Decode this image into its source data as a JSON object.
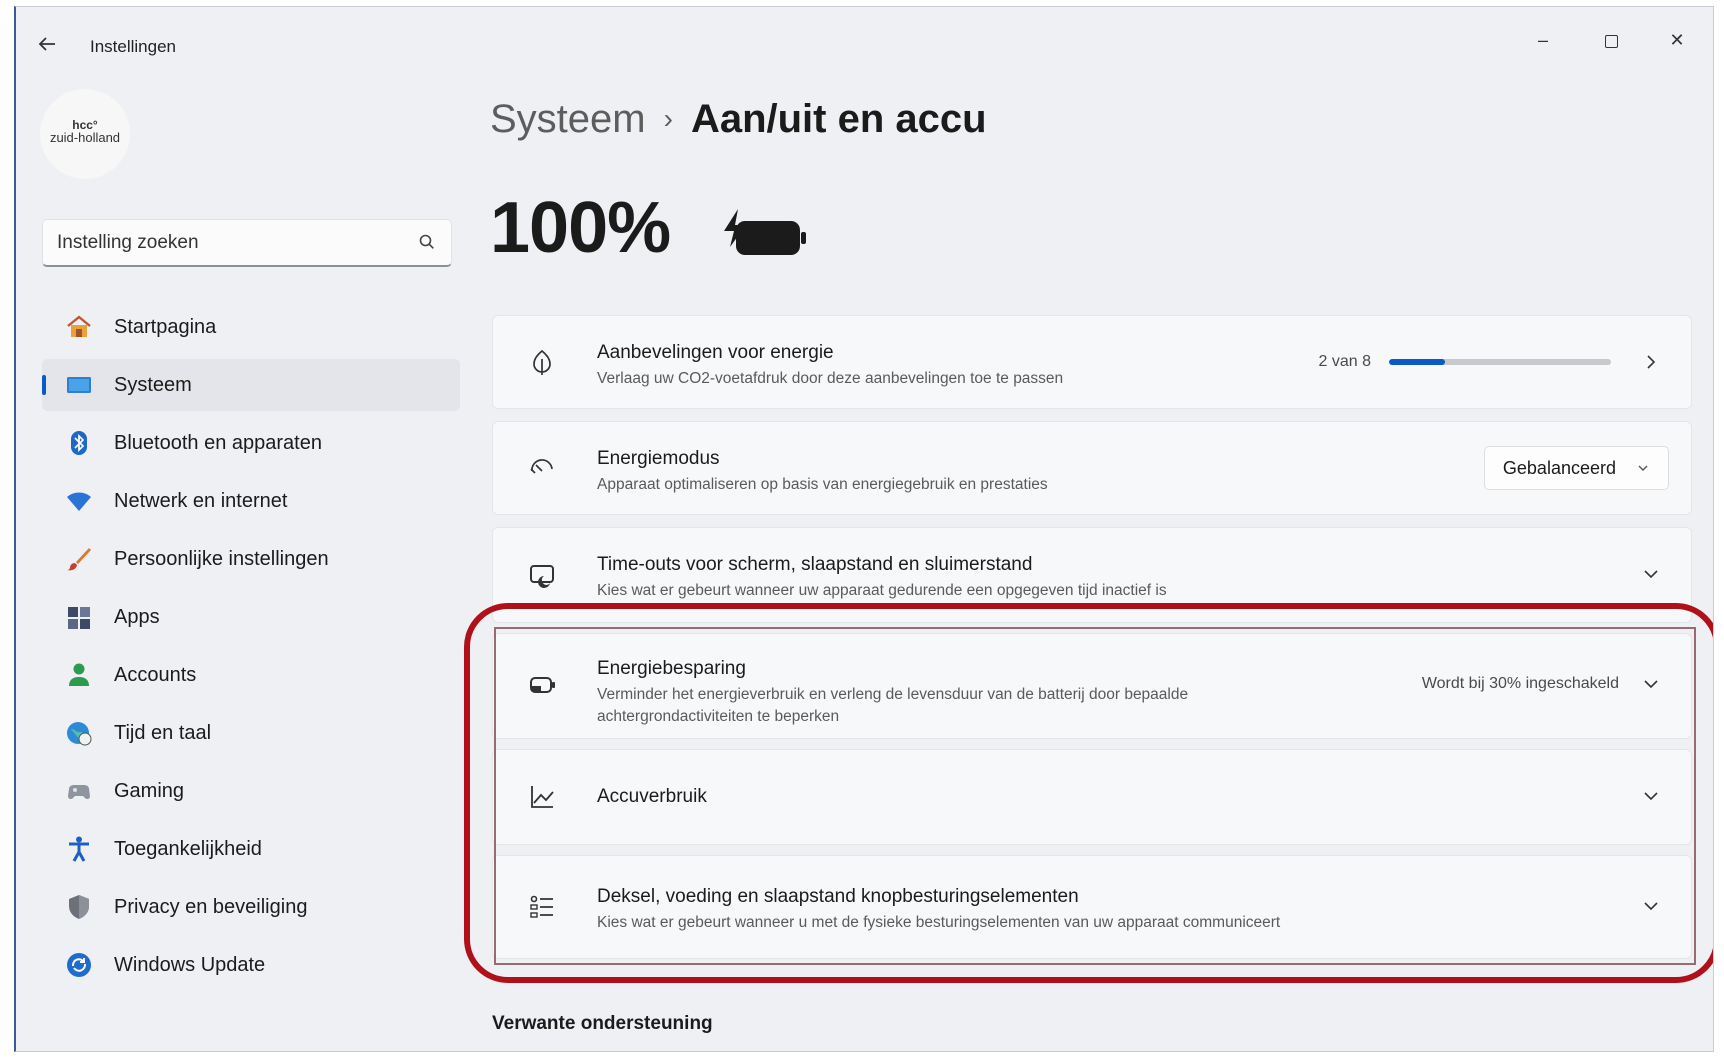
{
  "window": {
    "title": "Instellingen",
    "controls": {
      "minimize": "–",
      "close": "✕"
    }
  },
  "account": {
    "logo_line1": "hcc°",
    "logo_line2": "zuid-holland"
  },
  "search": {
    "placeholder": "Instelling zoeken"
  },
  "nav": {
    "items": [
      {
        "label": "Startpagina",
        "icon": "home-icon"
      },
      {
        "label": "Systeem",
        "icon": "system-icon",
        "active": true
      },
      {
        "label": "Bluetooth en apparaten",
        "icon": "bluetooth-icon"
      },
      {
        "label": "Netwerk en internet",
        "icon": "wifi-icon"
      },
      {
        "label": "Persoonlijke instellingen",
        "icon": "brush-icon"
      },
      {
        "label": "Apps",
        "icon": "apps-icon"
      },
      {
        "label": "Accounts",
        "icon": "accounts-icon"
      },
      {
        "label": "Tijd en taal",
        "icon": "globe-clock-icon"
      },
      {
        "label": "Gaming",
        "icon": "gamepad-icon"
      },
      {
        "label": "Toegankelijkheid",
        "icon": "accessibility-icon"
      },
      {
        "label": "Privacy en beveiliging",
        "icon": "shield-icon"
      },
      {
        "label": "Windows Update",
        "icon": "update-icon"
      }
    ]
  },
  "breadcrumb": {
    "parent": "Systeem",
    "separator": "›",
    "current": "Aan/uit en accu"
  },
  "battery": {
    "percent": "100%",
    "charging": true
  },
  "cards": {
    "recommendations": {
      "title": "Aanbevelingen voor energie",
      "subtitle": "Verlaag uw CO2-voetafdruk door deze aanbevelingen toe te passen",
      "progress_text": "2 van 8",
      "progress_value": 0.25
    },
    "power_mode": {
      "title": "Energiemodus",
      "subtitle": "Apparaat optimaliseren op basis van energiegebruik en prestaties",
      "selected": "Gebalanceerd"
    },
    "timeouts": {
      "title": "Time-outs voor scherm, slaapstand en sluimerstand",
      "subtitle": "Kies wat er gebeurt wanneer uw apparaat gedurende een opgegeven tijd inactief is"
    },
    "energy_saver": {
      "title": "Energiebesparing",
      "subtitle": "Verminder het energieverbruik en verleng de levensduur van de batterij door bepaalde achtergrondactiviteiten te beperken",
      "status": "Wordt bij 30% ingeschakeld"
    },
    "battery_usage": {
      "title": "Accuverbruik"
    },
    "lid_power": {
      "title": "Deksel, voeding en slaapstand knopbesturingselementen",
      "subtitle": "Kies wat er gebeurt wanneer u met de fysieke besturingselementen van uw apparaat communiceert"
    }
  },
  "related": {
    "heading": "Verwante ondersteuning"
  },
  "colors": {
    "accent": "#0a59c4",
    "highlight": "#b0101a"
  }
}
